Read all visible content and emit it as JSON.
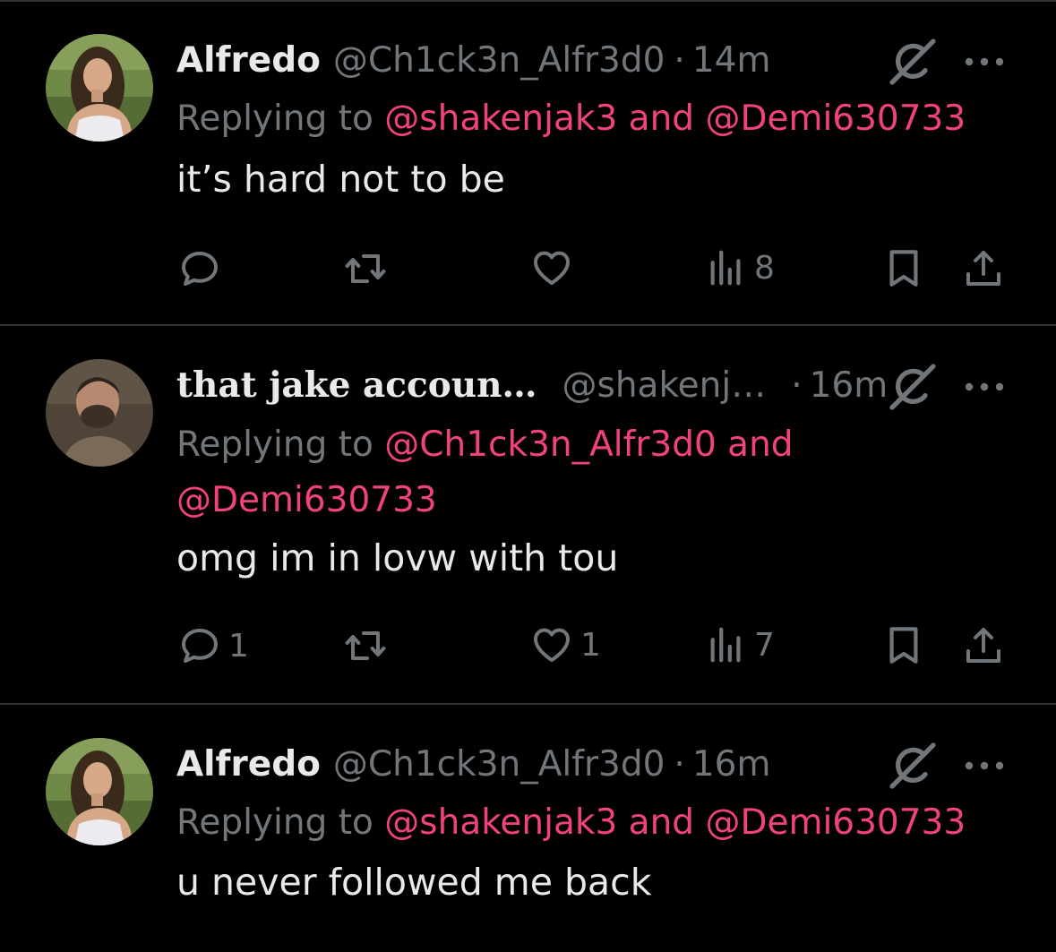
{
  "colors": {
    "background": "#000000",
    "text": "#e7e9ea",
    "secondary": "#71767b",
    "mention": "#f0437a",
    "divider": "#2f3336"
  },
  "tweets": [
    {
      "name": "Alfredo",
      "handle": "@Ch1ck3n_Alfr3d0",
      "separator": "·",
      "time": "14m",
      "replying_prefix": "Replying to",
      "replying_first": "@shakenjak3",
      "replying_and": "and",
      "replying_second": "@Demi630733",
      "text": "it’s hard not to be",
      "replies": "",
      "reposts": "",
      "likes": "",
      "views": "8",
      "icons": [
        "avatar",
        "grok-icon",
        "more-icon",
        "reply-icon",
        "repost-icon",
        "like-icon",
        "views-icon",
        "bookmark-icon",
        "share-icon"
      ]
    },
    {
      "name": "that jake accoun…",
      "handle": "@shakenj…",
      "separator": "·",
      "time": "16m",
      "replying_prefix": "Replying to",
      "replying_first": "@Ch1ck3n_Alfr3d0",
      "replying_and": "and",
      "replying_second": "@Demi630733",
      "text": "omg im in lovw with tou",
      "replies": "1",
      "reposts": "",
      "likes": "1",
      "views": "7"
    },
    {
      "name": "Alfredo",
      "handle": "@Ch1ck3n_Alfr3d0",
      "separator": "·",
      "time": "16m",
      "replying_prefix": "Replying to",
      "replying_first": "@shakenjak3",
      "replying_and": "and",
      "replying_second": "@Demi630733",
      "text": "u never followed me back"
    }
  ]
}
